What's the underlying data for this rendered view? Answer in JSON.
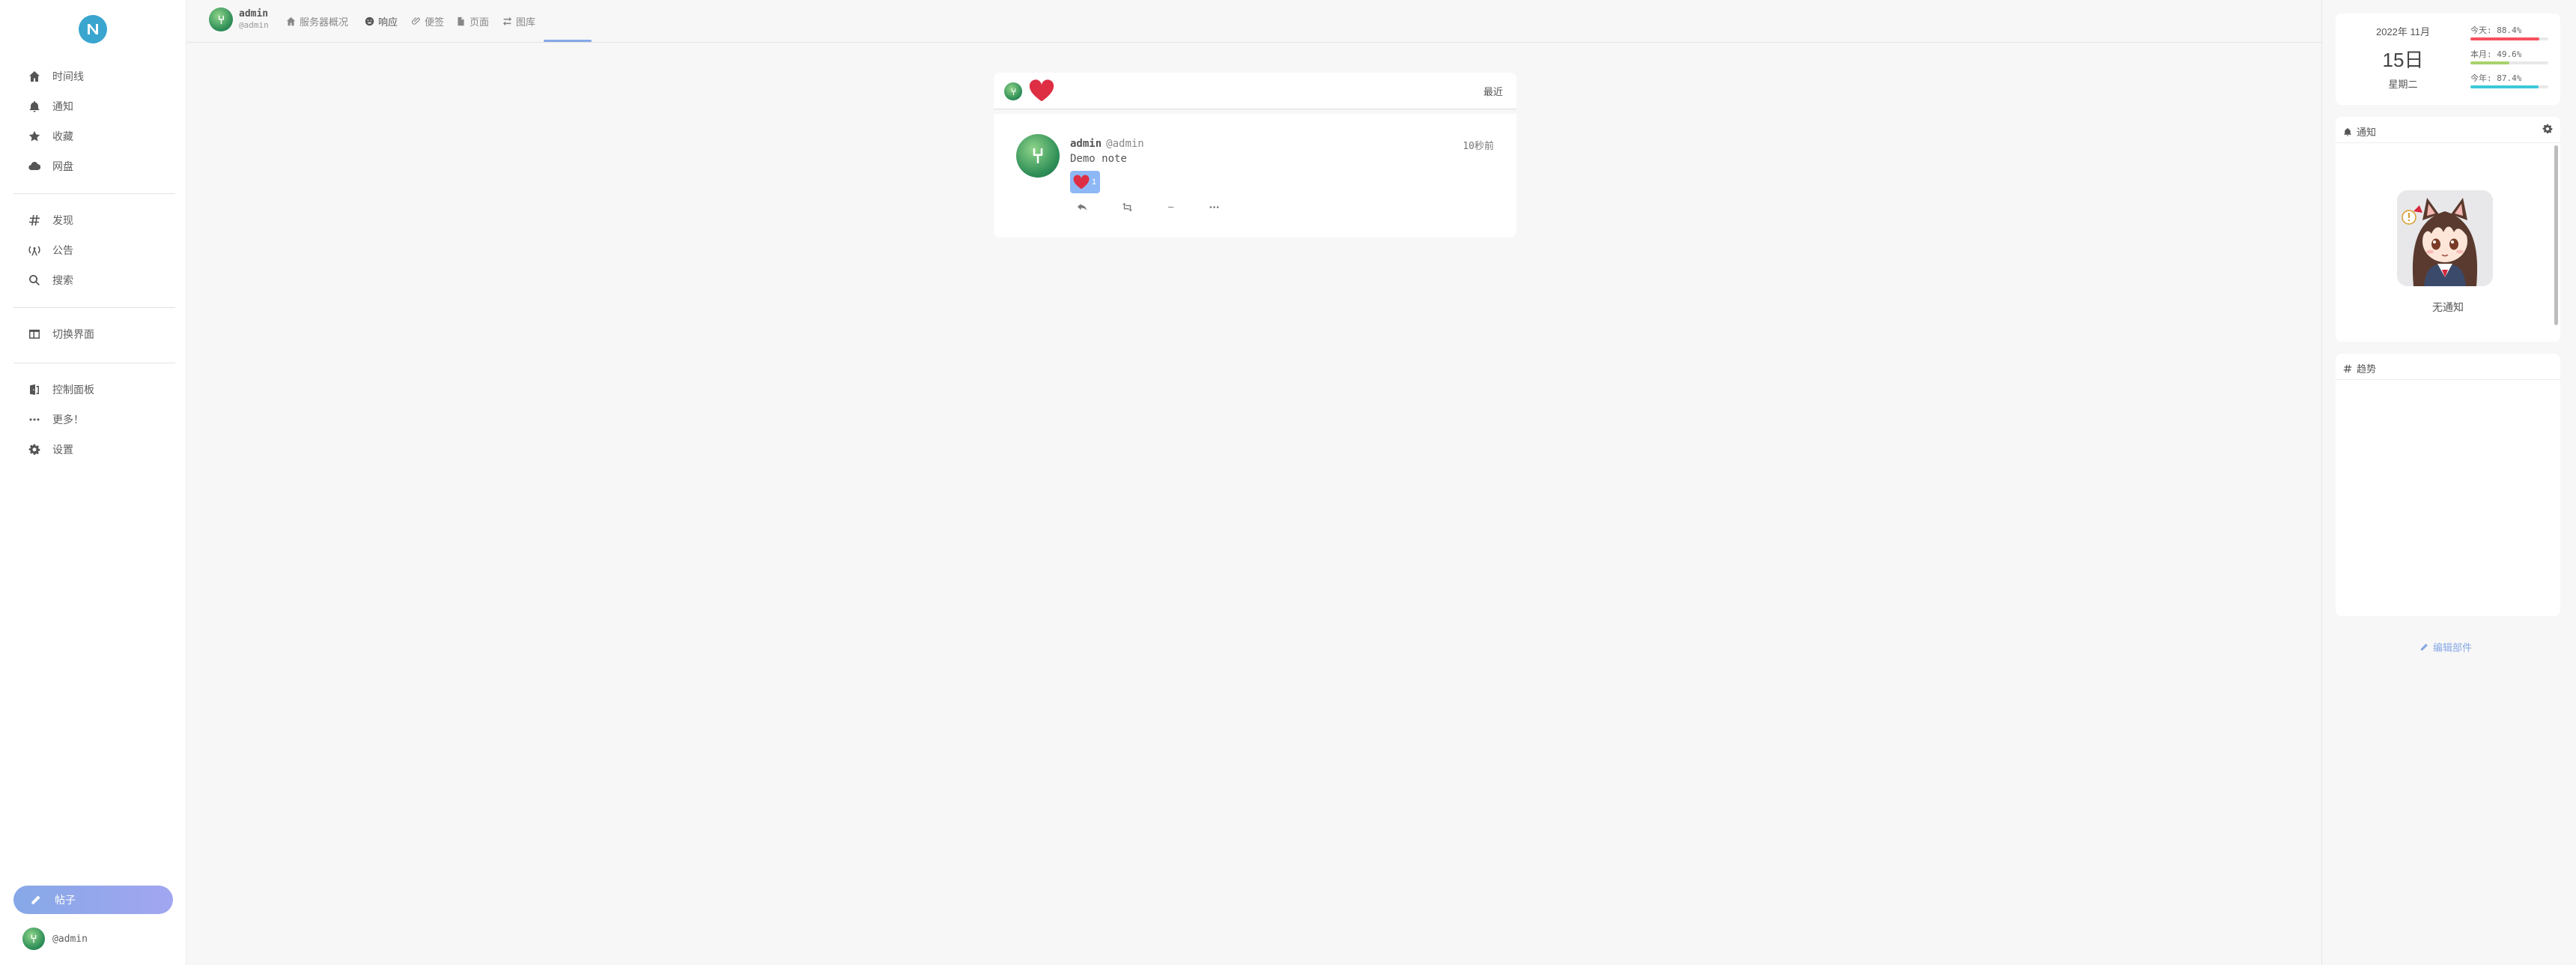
{
  "sidebar": {
    "logo_text": "N",
    "items": [
      {
        "label": "时间线",
        "icon": "home-icon"
      },
      {
        "label": "通知",
        "icon": "bell-icon"
      },
      {
        "label": "收藏",
        "icon": "star-icon"
      },
      {
        "label": "网盘",
        "icon": "cloud-icon"
      },
      {
        "label": "发现",
        "icon": "hashtag-icon"
      },
      {
        "label": "公告",
        "icon": "broadcast-icon"
      },
      {
        "label": "搜索",
        "icon": "search-icon"
      },
      {
        "label": "切换界面",
        "icon": "columns-icon"
      },
      {
        "label": "控制面板",
        "icon": "door-icon"
      },
      {
        "label": "更多！",
        "icon": "ellipsis-icon"
      },
      {
        "label": "设置",
        "icon": "gear-icon"
      }
    ],
    "post_button": "帖子",
    "me_acct": "@admin"
  },
  "header": {
    "user_name": "admin",
    "user_acct": "@admin",
    "tabs": [
      {
        "label": "服务器概况",
        "icon": "home-icon"
      },
      {
        "label": "响应",
        "icon": "smile-icon"
      },
      {
        "label": "便签",
        "icon": "paperclip-icon"
      },
      {
        "label": "页面",
        "icon": "file-icon"
      },
      {
        "label": "图库",
        "icon": "exchange-icon"
      }
    ],
    "active_tab": 1
  },
  "main": {
    "filter_label": "最近",
    "note": {
      "name": "admin",
      "acct": "@admin",
      "time": "10秒前",
      "text": "Demo note",
      "reaction_count": "1"
    }
  },
  "right": {
    "date": {
      "year_month": "2022年 11月",
      "day": "15日",
      "weekday": "星期二",
      "stats": [
        {
          "label": "今天: 88.4%",
          "value": 88.4,
          "color": "#f5515f"
        },
        {
          "label": "本月: 49.6%",
          "value": 49.6,
          "color": "#a8d26c"
        },
        {
          "label": "今年: 87.4%",
          "value": 87.4,
          "color": "#3cc9d8"
        }
      ]
    },
    "notifications_title": "通知",
    "no_notifications": "无通知",
    "trends_title": "趋势",
    "edit_widgets": "编辑部件"
  },
  "colors": {
    "accent": "#86a8e7",
    "reaction_bg": "#8eb8f5",
    "heart": "#dd2e44"
  }
}
